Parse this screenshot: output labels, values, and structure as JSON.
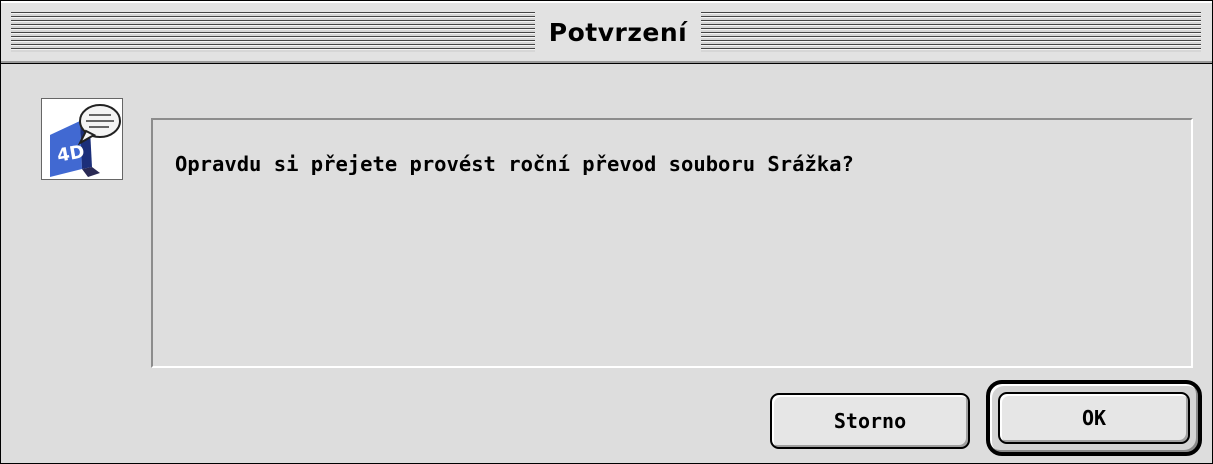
{
  "window": {
    "title": "Potvrzení"
  },
  "dialog": {
    "message": "Opravdu si přejete provést roční převod souboru Srážka?",
    "icon": "4d-app-speech-bubble-icon"
  },
  "buttons": {
    "cancel_label": "Storno",
    "ok_label": "OK"
  },
  "colors": {
    "background": "#dddddd",
    "icon_blue": "#3f63c6"
  }
}
